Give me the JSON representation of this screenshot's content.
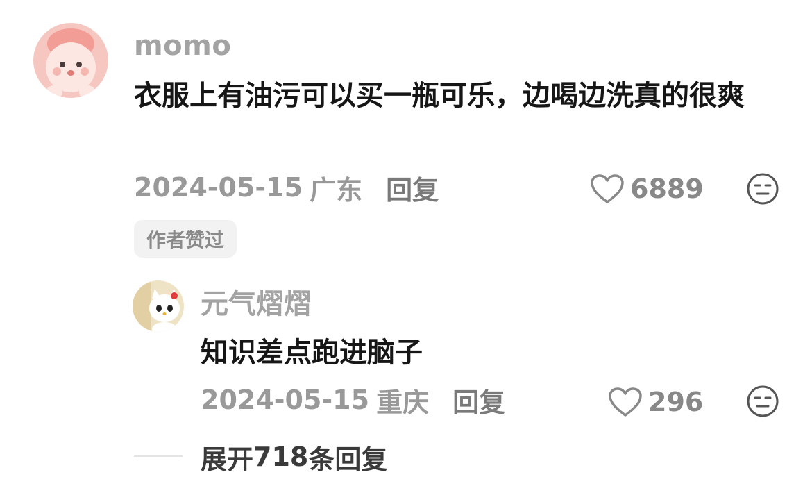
{
  "comment": {
    "username": "momo",
    "avatar_icon": "pink-bunny-avatar-icon",
    "text": "衣服上有油污可以买一瓶可乐，边喝边洗真的很爽",
    "date": "2024-05-15",
    "location": "广东",
    "reply_label": "回复",
    "likes": "6889",
    "author_liked_badge": "作者赞过"
  },
  "reply": {
    "username": "元气熠熠",
    "avatar_icon": "cartoon-cat-avatar-icon",
    "text": "知识差点跑进脑子",
    "date": "2024-05-15",
    "location": "重庆",
    "reply_label": "回复",
    "likes": "296"
  },
  "expand": {
    "prefix": "展开",
    "count": "718",
    "suffix": "条回复"
  },
  "colors": {
    "username": "#a3a3a3",
    "text": "#161616",
    "meta": "#999999",
    "badge_bg": "#f2f2f2"
  }
}
